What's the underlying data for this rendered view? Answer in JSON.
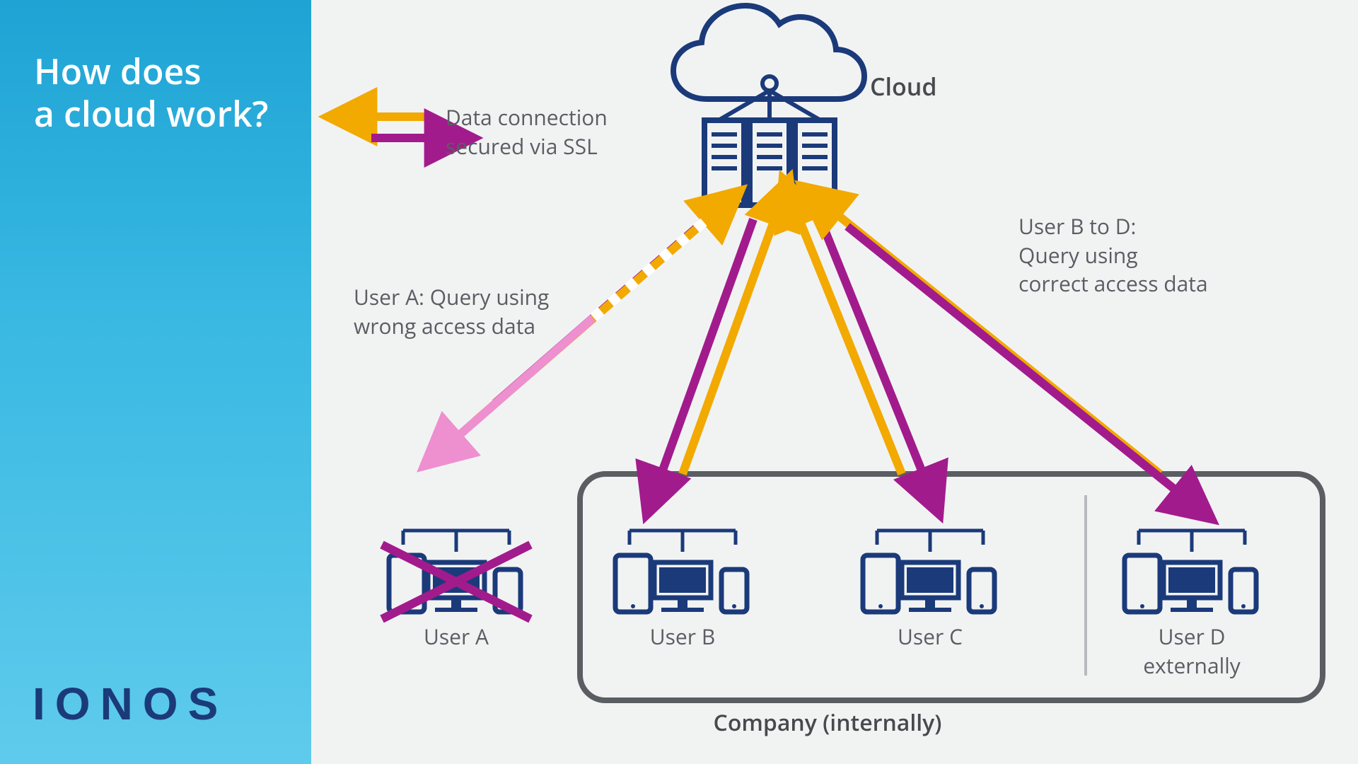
{
  "sidebar": {
    "title_line1": "How does",
    "title_line2": "a cloud work?",
    "brand": "IONOS"
  },
  "legend": {
    "line1": "Data connection",
    "line2": "secured via SSL"
  },
  "cloud_label": "Cloud",
  "annotations": {
    "left_line1": "User A: Query using",
    "left_line2": "wrong access data",
    "right_line1": "User B to D:",
    "right_line2": "Query using",
    "right_line3": "correct access data"
  },
  "users": {
    "a": "User A",
    "b": "User B",
    "c": "User C",
    "d_line1": "User D",
    "d_line2": "externally"
  },
  "company": "Company (internally)",
  "colors": {
    "navy": "#1b3a7a",
    "amber": "#f2a900",
    "magenta": "#a21b8c",
    "pink": "#ee8fd0",
    "grey": "#5a5e63",
    "sidebar_top": "#1ea3d4"
  }
}
